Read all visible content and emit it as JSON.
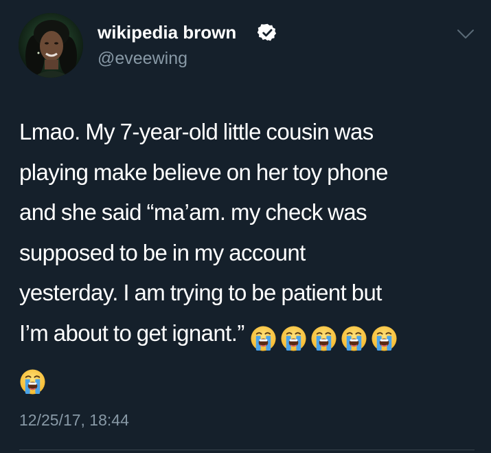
{
  "tweet": {
    "author": {
      "display_name": "wikipedia brown",
      "handle": "@eveewing",
      "verified": true,
      "avatar_icon": "profile-photo"
    },
    "text_lines": [
      "Lmao. My 7-year-old little cousin was",
      "playing make believe on her toy phone",
      "and she said “ma’am. my check was",
      "supposed to be in my account",
      "yesterday. I am trying to be patient but",
      "I’m about to get ignant.”"
    ],
    "emoji": [
      "😭",
      "😭",
      "😭",
      "😭",
      "😭",
      "😭"
    ],
    "emoji_name": "loudly-crying-face",
    "timestamp": "12/25/17, 18:44"
  },
  "colors": {
    "background": "#15202b",
    "text": "#ffffff",
    "secondary_text": "#8899a6",
    "verified_badge": "#ffffff",
    "divider": "#38444d"
  }
}
